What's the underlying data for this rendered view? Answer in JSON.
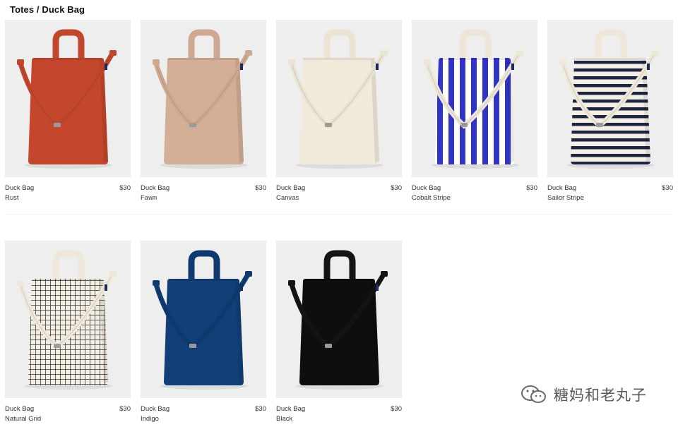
{
  "breadcrumb": "Totes / Duck Bag",
  "products": [
    {
      "name": "Duck Bag",
      "color": "Rust",
      "price": "$30",
      "bag_color": "#c4472d",
      "strap_color": "#c0462c",
      "pattern": "solid"
    },
    {
      "name": "Duck Bag",
      "color": "Fawn",
      "price": "$30",
      "bag_color": "#d3af97",
      "strap_color": "#cfa891",
      "pattern": "solid"
    },
    {
      "name": "Duck Bag",
      "color": "Canvas",
      "price": "$30",
      "bag_color": "#f2ebdc",
      "strap_color": "#ece4d2",
      "pattern": "solid"
    },
    {
      "name": "Duck Bag",
      "color": "Cobalt Stripe",
      "price": "$30",
      "bag_color": "#ffffff",
      "strap_color": "#ede6d6",
      "pattern": "vstripe",
      "stripe_color": "#2f33c9"
    },
    {
      "name": "Duck Bag",
      "color": "Sailor Stripe",
      "price": "$30",
      "bag_color": "#f4efe3",
      "strap_color": "#efe8d8",
      "pattern": "hstripe",
      "stripe_color": "#1e2544"
    },
    {
      "name": "Duck Bag",
      "color": "Natural Grid",
      "price": "$30",
      "bag_color": "#f3ede2",
      "strap_color": "#efe7d9",
      "pattern": "grid",
      "stripe_color": "#3a3a3a"
    },
    {
      "name": "Duck Bag",
      "color": "Indigo",
      "price": "$30",
      "bag_color": "#123f78",
      "strap_color": "#0f3a70",
      "pattern": "solid"
    },
    {
      "name": "Duck Bag",
      "color": "Black",
      "price": "$30",
      "bag_color": "#0e0e0e",
      "strap_color": "#141414",
      "pattern": "solid"
    }
  ],
  "watermark": {
    "text": "糖妈和老丸子"
  }
}
